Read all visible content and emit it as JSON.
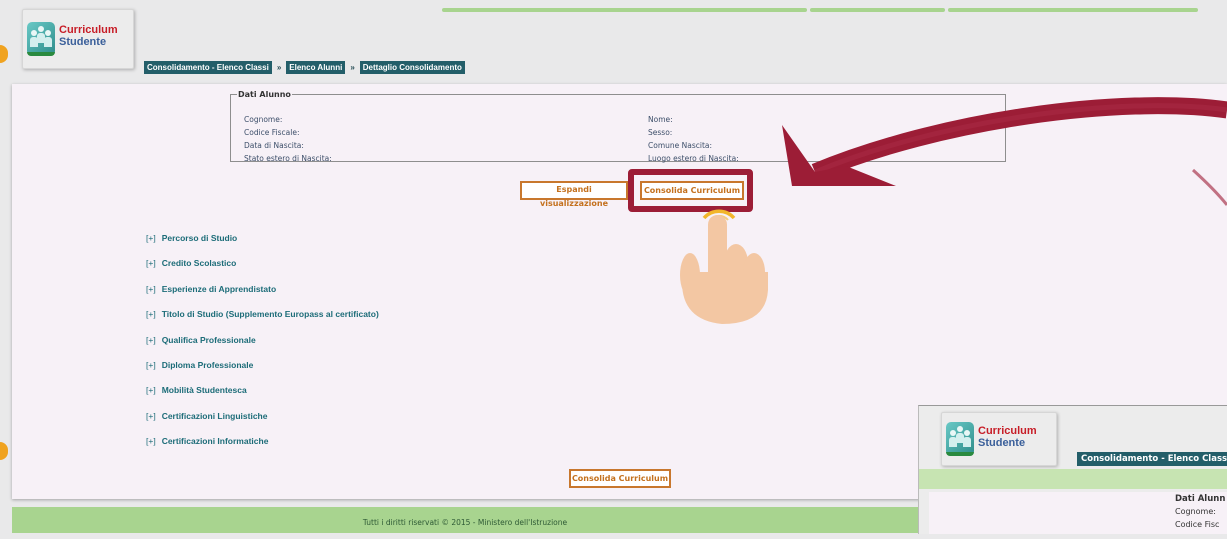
{
  "app": {
    "logo_line1": "Curriculum",
    "logo_line2": "Studente"
  },
  "breadcrumb": [
    {
      "label": "Consolidamento - Elenco Classi"
    },
    {
      "label": "Elenco Alunni"
    },
    {
      "label": "Dettaglio Consolidamento"
    }
  ],
  "breadcrumb_separator": "»",
  "dati_alunno": {
    "legend": "Dati Alunno",
    "cognome": "Cognome:",
    "codice_fiscale": "Codice Fiscale:",
    "data_nascita": "Data di Nascita:",
    "stato_estero": "Stato estero di Nascita:",
    "nome": "Nome:",
    "sesso": "Sesso:",
    "comune_nascita": "Comune Nascita:",
    "luogo_estero": "Luogo estero di Nascita:"
  },
  "buttons": {
    "espandi": "Espandi visualizzazione",
    "consolida": "Consolida Curriculum",
    "consolida_bottom": "Consolida Curriculum"
  },
  "sections": [
    {
      "toggle": "[+]",
      "label": "Percorso di Studio"
    },
    {
      "toggle": "[+]",
      "label": "Credito Scolastico"
    },
    {
      "toggle": "[+]",
      "label": "Esperienze di Apprendistato"
    },
    {
      "toggle": "[+]",
      "label": "Titolo di Studio (Supplemento Europass al certificato)"
    },
    {
      "toggle": "[+]",
      "label": "Qualifica Professionale"
    },
    {
      "toggle": "[+]",
      "label": "Diploma Professionale"
    },
    {
      "toggle": "[+]",
      "label": "Mobilità Studentesca"
    },
    {
      "toggle": "[+]",
      "label": "Certificazioni Linguistiche"
    },
    {
      "toggle": "[+]",
      "label": "Certificazioni Informatiche"
    }
  ],
  "footer": {
    "text": "Tutti i diritti riservati © 2015 -  Ministero dell'Istruzione"
  },
  "inset": {
    "logo_line1": "Curriculum",
    "logo_line2": "Studente",
    "crumb": "Consolidamento - Elenco Classi",
    "legend": "Dati Alunn",
    "cognome": "Cognome:",
    "codice_partial": "Codice Fisc"
  },
  "colors": {
    "accent_dark_red": "#9c1d36",
    "button_orange": "#c8772d",
    "breadcrumb_bg": "#235e69",
    "footer_green": "#a8d48f",
    "section_link": "#1c6c78",
    "hand_skin": "#f3c7a3",
    "tap_ring": "#f2b62a"
  },
  "icons": [
    "people-logo-icon",
    "curved-arrow-icon",
    "pointing-hand-icon"
  ]
}
